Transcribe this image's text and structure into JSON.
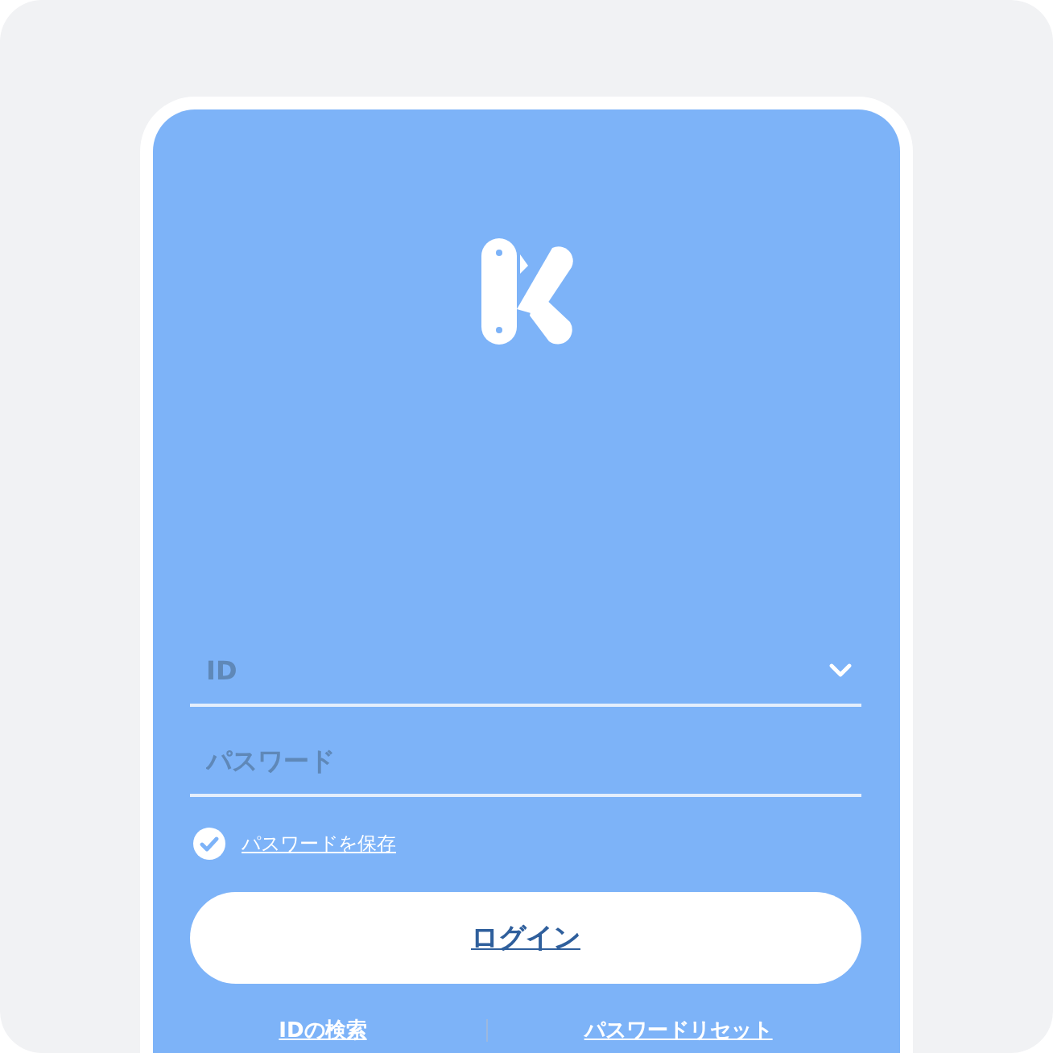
{
  "fields": [
    {
      "kind": "dropdown",
      "placeholder": "ID"
    },
    {
      "kind": "password",
      "placeholder": "パスワード"
    }
  ],
  "remember": {
    "label": "パスワードを保存",
    "checked": true
  },
  "login_button": "ログイン",
  "links": [
    "IDの検索",
    "パスワードリセット"
  ]
}
